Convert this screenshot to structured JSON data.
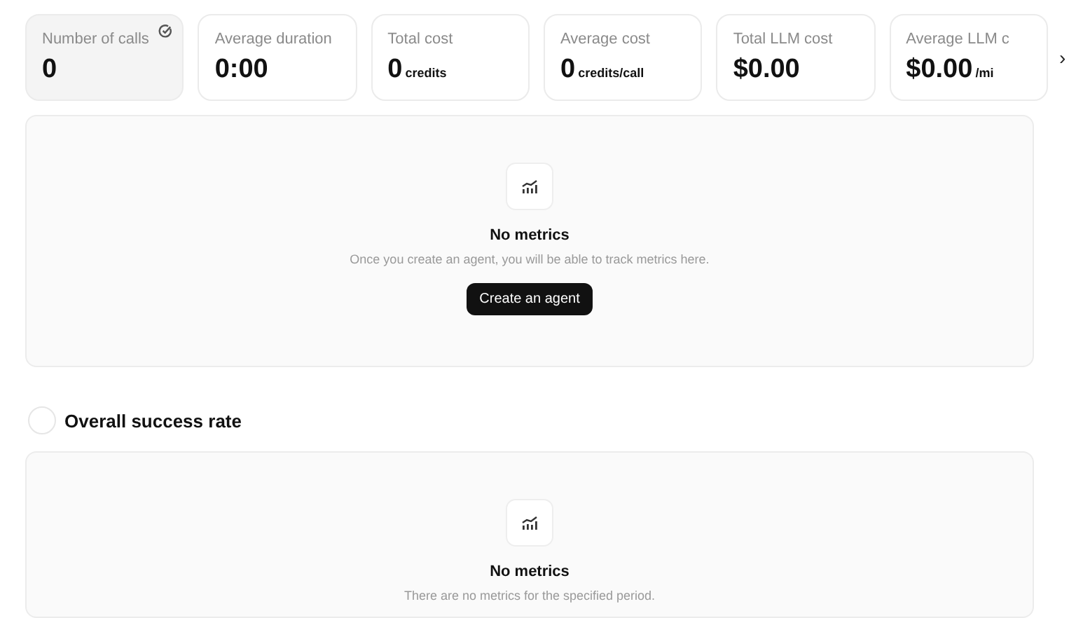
{
  "stat_cards": [
    {
      "label": "Number of calls",
      "value": "0",
      "selected": true
    },
    {
      "label": "Average duration",
      "value": "0:00",
      "selected": false
    },
    {
      "label": "Total cost",
      "value": "0",
      "unit": "credits",
      "selected": false
    },
    {
      "label": "Average cost",
      "value": "0",
      "unit": "credits/call",
      "selected": false
    },
    {
      "label": "Total LLM cost",
      "value": "$0.00",
      "selected": false
    },
    {
      "label": "Average LLM c",
      "value": "$0.00",
      "unit": "/mi",
      "selected": false
    }
  ],
  "next_arrow": "›",
  "metrics_panel": {
    "title": "No metrics",
    "message": "Once you create an agent, you will be able to track metrics here.",
    "button": "Create an agent"
  },
  "success_rate": {
    "title": "Overall success rate",
    "panel": {
      "title": "No metrics",
      "message": "There are no metrics for the specified period."
    }
  }
}
